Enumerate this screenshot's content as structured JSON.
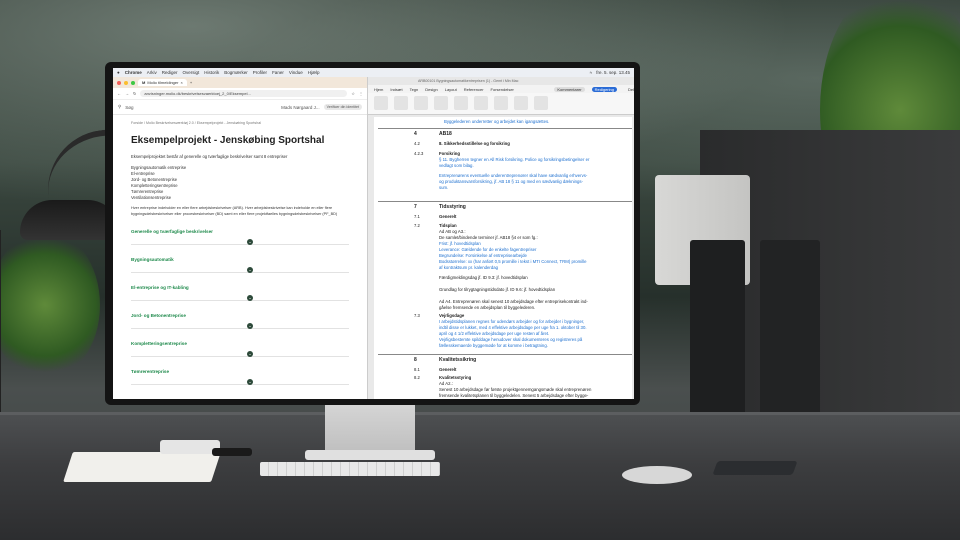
{
  "mac_menubar": {
    "items": [
      "Chrome",
      "Arkiv",
      "Rediger",
      "Oversigt",
      "Historik",
      "Bogmærker",
      "Profiler",
      "Faner",
      "Vindue",
      "Hjælp"
    ],
    "clock": "fre. 5. sep. 13.45"
  },
  "browser": {
    "tab_label": "Molio tilmeldinger",
    "url": "anvisninger.molio.dk/beskrivelsesvaerktoej_2_0/Eksempel...",
    "search_placeholder": "Søg",
    "user_button": "Mads Nørgaard J...",
    "verify_badge": "Verificer din identitet"
  },
  "page": {
    "breadcrumb": "Forside  /  Molio Beskrivelsesværktøj 2.0  /  Eksempelprojekt - Jenskøbing Sportshal",
    "title": "Eksempelprojekt - Jenskøbing Sportshal",
    "intro": "Eksempelprojektet består af generelle og tværfaglige beskrivelser samt 8 entrepriser",
    "entreprises": [
      "Bygningsautomatik entreprise",
      "El-entreprise",
      "Jord- og Betonentreprise",
      "Kompletteringsentreprise",
      "Tømrerentreprise",
      "Ventilationsentreprise"
    ],
    "explainer": "Hver entreprise indeholder en eller flere arbejdsbeskrivelser (ARB). Hver arbejdsbeskrivelse kan indeholde en eller flere bygningsdelsbeskrivelser eller procesbeskrivelser (BD) samt en eller flere projektfaelles bygningsdelsbeskrivelser (PF_BD)",
    "sections": [
      "Generelle og tværfaglige beskrivelser",
      "Bygningsautomatik",
      "El-entreprise og IT-kabling",
      "Jord- og Betonentreprise",
      "Kompletteringsentreprise",
      "Tømrerentreprise"
    ]
  },
  "word": {
    "window_title": "ARB00101 Bygningsautomatikentreprisen (1) - Gemt i Min Mac",
    "tabs": [
      "Hjem",
      "Indsæt",
      "Tegn",
      "Design",
      "Layout",
      "Referencer",
      "Forsendelser"
    ],
    "comments_button": "Kommentarer",
    "editing_button": "Redigering",
    "share_button": "Del",
    "top_line": "Byggelederen underretter og arbejdet kan igangsættes.",
    "s4": {
      "num": "4",
      "title": "AB18"
    },
    "s42": {
      "num": "4.2",
      "title": "8. Sikkerhedsstillelse og forsikring"
    },
    "s423": {
      "num": "4.2.3",
      "title": "Forsikring",
      "line1": "§ 11. Bygherren tegner en All Risk forsikring. Police og forsikringsbetingelser er",
      "line2": "vedlagt som bilag.",
      "line3": "Entreprenørens eventuelle underentreprenører skal have sædvanlig erhvervs-",
      "line4": "og produktansvarsforsikring, jf. AB 18 § 11 og med en sædvanlig dæknings-",
      "line5": "sum."
    },
    "s7": {
      "num": "7",
      "title": "Tidsstyring"
    },
    "s71": {
      "num": "7.1",
      "title": "Generelt"
    },
    "s72": {
      "num": "7.2",
      "title": "Tidsplan",
      "l1": "Ad AB og A3.:",
      "l2": "De samlet/bindende terminer jf. AB18 §4 er som fg.:",
      "l3": "Frist: jf. hovedtidsplan",
      "l4": "Leverance:  Gældende for de enkelte fagentrepriser",
      "l5": "Begrundelse:  Forsinkelse af entreprisearbejde",
      "l6": "Bodsstørrelse:  xx (har anført 0,5 promille i tekst i MTI Connect, TRM) promille",
      "l7": "af kontraktsum pr. kalenderdag",
      "l8": "Færdigmeldingsdag jf. ID 9.3: jf. hovedtidsplan",
      "l9": "Grundlag for tilrygtagningstidsdato jf. ID 9.6: jf. hovedtidsplan",
      "l10": "Ad A4. Entreprenøren skal senest 10 arbejdsdage efter entreprisekontrakt ind-",
      "l11": "gåelse fremsende en arbejdsplan til byggelederen."
    },
    "s73": {
      "num": "7.3",
      "title": "Vejrligsdage",
      "l1": "I arbejdstidsplanen regnes for udendørs arbejder og for arbejder i bygninger,",
      "l2": "indtil disse er lukket, med 4 effektive arbejdsdage per uge fra 1. oktober til 30.",
      "l3": "april og 4 1/2 effektive arbejdsdage per uge resten af året.",
      "l4": "Vejrligsbestemte spilddage henudover skal dokumenteres og registreres på",
      "l5": "fællesskemaerde byggemøde for at komme i betragtning."
    },
    "s8": {
      "num": "8",
      "title": "Kvalitetssikring"
    },
    "s81": {
      "num": "8.1",
      "title": "Generelt"
    },
    "s82": {
      "num": "8.2",
      "title": "Kvalitetsstyring",
      "l1": "Ad A2.:",
      "l2": "Senest 10 arbejdsdage før første projektgennemgangsmøde skal entreprenøren",
      "l3": "fremsende kvalitetsplanen til byggeledelen. Senest 5 arbejdsdage efter bygge-",
      "l4": "ledelens eventuelle kommentarer til kvalitetsplanen skal entreprenøren frem-"
    }
  }
}
